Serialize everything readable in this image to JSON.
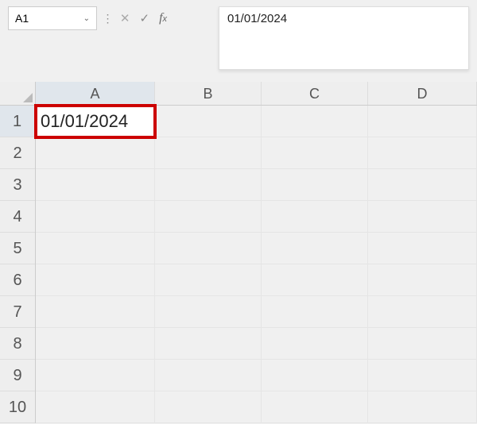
{
  "formula_bar": {
    "name_box_value": "A1",
    "formula_value": "01/01/2024"
  },
  "columns": [
    {
      "label": "A",
      "class": "colA",
      "selected": true
    },
    {
      "label": "B",
      "class": "colB",
      "selected": false
    },
    {
      "label": "C",
      "class": "colC",
      "selected": false
    },
    {
      "label": "D",
      "class": "colD",
      "selected": false
    }
  ],
  "rows": [
    {
      "label": "1",
      "selected": true
    },
    {
      "label": "2",
      "selected": false
    },
    {
      "label": "3",
      "selected": false
    },
    {
      "label": "4",
      "selected": false
    },
    {
      "label": "5",
      "selected": false
    },
    {
      "label": "6",
      "selected": false
    },
    {
      "label": "7",
      "selected": false
    },
    {
      "label": "8",
      "selected": false
    },
    {
      "label": "9",
      "selected": false
    },
    {
      "label": "10",
      "selected": false
    }
  ],
  "active_cell": {
    "row": 0,
    "col": 0,
    "value": "01/01/2024"
  }
}
